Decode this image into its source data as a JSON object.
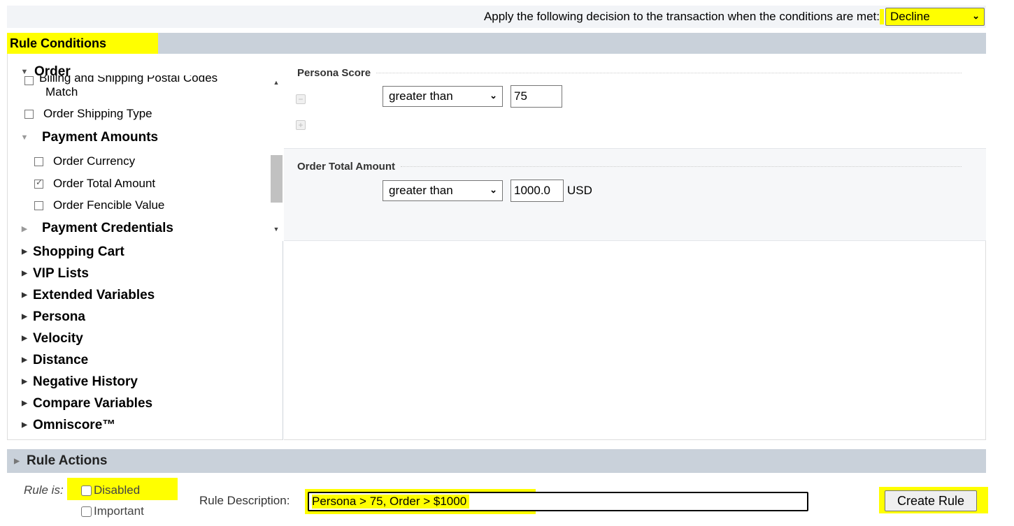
{
  "decision": {
    "label": "Apply the following decision to the transaction when the conditions are met:",
    "selected": "Decline"
  },
  "rule_conditions": {
    "title": "Rule Conditions"
  },
  "tree": {
    "order_label": "Order",
    "partial_item": "Billing and Shipping Postal Codes",
    "partial_item_cont": "Match",
    "order_shipping_type": "Order Shipping Type",
    "payment_amounts": "Payment Amounts",
    "order_currency": "Order Currency",
    "order_total_amount": "Order Total Amount",
    "order_fencible_value": "Order Fencible Value",
    "payment_credentials": "Payment Credentials",
    "groups": [
      "Shopping Cart",
      "VIP Lists",
      "Extended Variables",
      "Persona",
      "Velocity",
      "Distance",
      "Negative History",
      "Compare Variables",
      "Omniscore™"
    ]
  },
  "conditions": {
    "persona_score": {
      "title": "Persona Score",
      "operator": "greater than",
      "value": "75"
    },
    "order_total": {
      "title": "Order Total Amount",
      "operator": "greater than",
      "value": "1000.0",
      "unit": "USD"
    }
  },
  "rule_actions": {
    "title": "Rule Actions"
  },
  "form": {
    "rule_is": "Rule is:",
    "disabled": "Disabled",
    "important": "Important",
    "description_label": "Rule Description:",
    "description_value": "Persona > 75, Order > $1000",
    "create_button": "Create Rule"
  },
  "colors": {
    "highlight": "#ffff00",
    "header_bg": "#c9d1da",
    "panel_bg": "#f6f7f9"
  }
}
